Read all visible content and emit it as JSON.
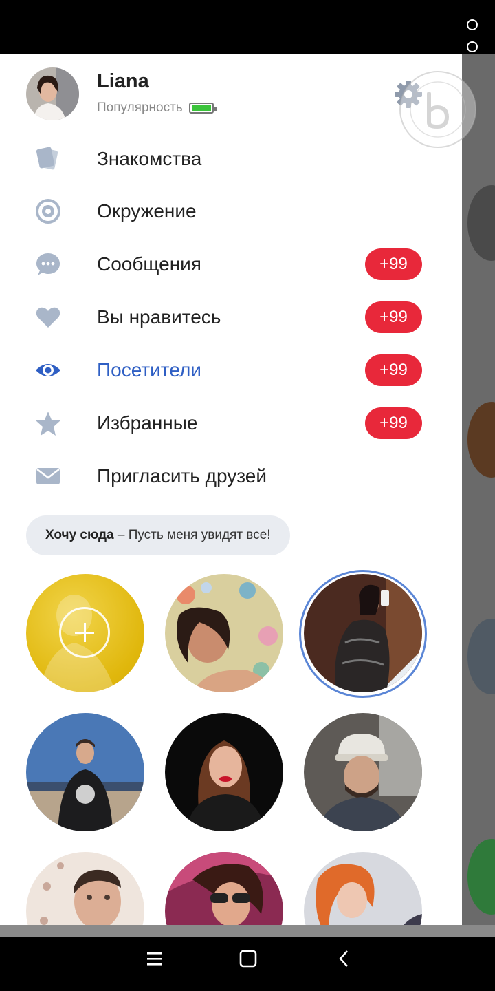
{
  "profile": {
    "name": "Liana",
    "popularity_label": "Популярность",
    "popularity_level": 1.0
  },
  "menu": [
    {
      "id": "encounters",
      "label": "Знакомства",
      "icon": "cards-icon",
      "badge": ""
    },
    {
      "id": "people-nearby",
      "label": "Окружение",
      "icon": "target-icon",
      "badge": ""
    },
    {
      "id": "messages",
      "label": "Сообщения",
      "icon": "chat-bubble-icon",
      "badge": "+99"
    },
    {
      "id": "liked-you",
      "label": "Вы нравитесь",
      "icon": "heart-icon",
      "badge": "+99"
    },
    {
      "id": "visitors",
      "label": "Посетители",
      "icon": "eye-icon",
      "badge": "+99",
      "active": true
    },
    {
      "id": "favourites",
      "label": "Избранные",
      "icon": "star-icon",
      "badge": "+99"
    },
    {
      "id": "invite-friends",
      "label": "Пригласить друзей",
      "icon": "envelope-icon",
      "badge": ""
    }
  ],
  "spotlight": {
    "title": "Хочу сюда",
    "separator": " – ",
    "text": "Пусть меня увидят все!"
  },
  "photos": {
    "add_icon": "plus-icon",
    "count_visible": 8
  },
  "colors": {
    "accent": "#2f5fc4",
    "badge": "#e8283a",
    "battery": "#3bc43b",
    "add_photo": "#e0b70c",
    "menu_icon": "#a9b6c9"
  },
  "system": {
    "nav": [
      "menu-icon",
      "home-icon",
      "back-icon"
    ]
  }
}
